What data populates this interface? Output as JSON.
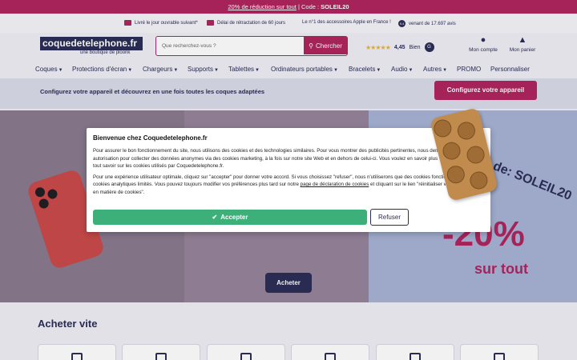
{
  "promo_bar": {
    "offer": "20% de réduction sur tout",
    "separator": " | Code : ",
    "code": "SOLEIL20"
  },
  "info_bar": {
    "delivery": "Livré le jour ouvrable suivant*",
    "returns": "Délai de rétractation de 60 jours",
    "leader": "Le n°1 des accessoires Apple en France !",
    "reviews_score": "9.4",
    "reviews": "venant de 17.697 avis"
  },
  "header": {
    "logo_text": "coquedetelephone.fr",
    "logo_subtitle": "une boutique de ploonk",
    "search_placeholder": "Que recherchez-vous ?",
    "search_button": "Chercher",
    "rating_value": "4,45",
    "rating_label": "Bien",
    "rating_badge": "G",
    "account_label": "Mon compte",
    "cart_label": "Mon panier"
  },
  "nav": {
    "items": [
      {
        "label": "Coques"
      },
      {
        "label": "Protections d'écran"
      },
      {
        "label": "Chargeurs"
      },
      {
        "label": "Supports"
      },
      {
        "label": "Tablettes"
      },
      {
        "label": "Ordinateurs portables"
      },
      {
        "label": "Bracelets"
      },
      {
        "label": "Audio"
      },
      {
        "label": "Autres"
      },
      {
        "label": "PROMO"
      },
      {
        "label": "Personnaliser"
      }
    ]
  },
  "config_bar": {
    "text": "Configurez votre appareil et découvrez en une fois toutes les coques adaptées",
    "button": "Configurez votre appareil"
  },
  "hero": {
    "code_text": "de: SOLEIL20",
    "discount": "-20%",
    "discount_sub": "sur tout",
    "cta": "Acheter"
  },
  "section": {
    "title": "Acheter vite"
  },
  "cookie_modal": {
    "title": "Bienvenue chez Coquedetelephone.fr",
    "para1_a": "Pour assurer le bon fonctionnement du site, nous utilisons des cookies et des technologies similaires. Pour vous montrer des publicités pertinentes, nous demandons votre autorisation pour collecter des données anonymes via des cookies marketing, à la fois sur notre site Web et en dehors de celui-ci. Vous voulez en savoir plus ? Cliquez ",
    "para1_link": "ici",
    "para1_b": " pour tout savoir sur les cookies utilisés par Coquedetelephone.fr.",
    "para2_a": "Pour une expérience utilisateur optimale, cliquez sur \"accepter\" pour donner votre accord. Si vous choisissez \"refuser\", nous n'utiliserons que des cookies fonctionnels et des cookies analytiques limités. Vous pouvez toujours modifier vos préférences plus tard sur notre ",
    "para2_link": "page de déclaration de cookies",
    "para2_b": " et cliquant sur le lien \"réinitialiser vos préférences en matière de cookies\".",
    "accept": "Accepter",
    "refuse": "Refuser"
  },
  "colors": {
    "brand": "#b0255d",
    "navy": "#2b2d55",
    "accept": "#3db07a"
  }
}
